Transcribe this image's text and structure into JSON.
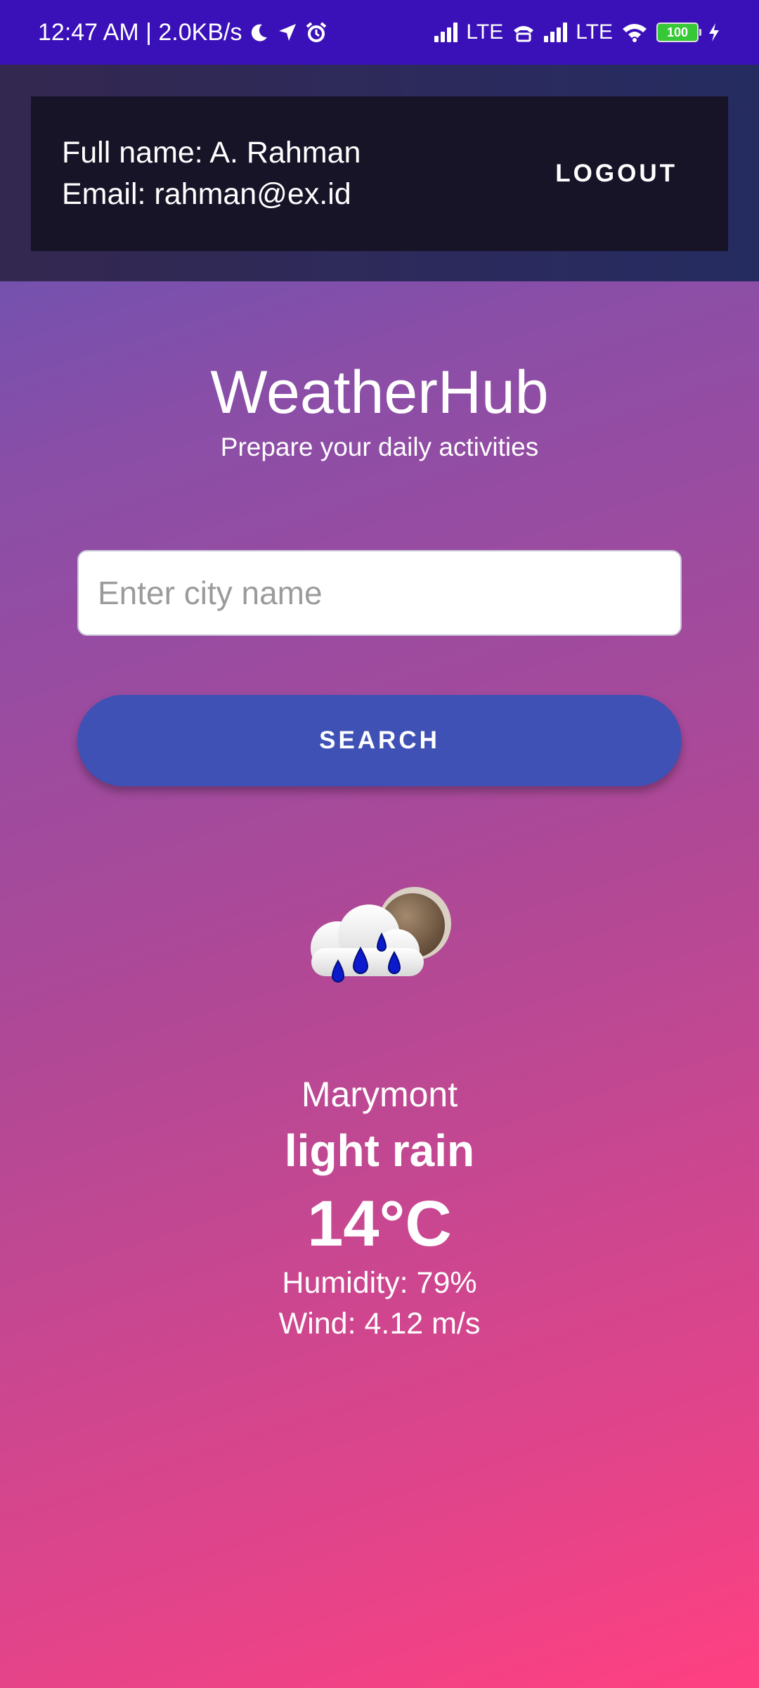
{
  "status_bar": {
    "time_speed": "12:47 AM | 2.0KB/s",
    "network_1": "LTE",
    "network_2": "LTE",
    "battery_level": "100",
    "icons": [
      "moon-icon",
      "location-arrow-icon",
      "alarm-icon",
      "signal-icon",
      "volte-icon",
      "signal-icon",
      "wifi-icon",
      "battery-icon",
      "charging-icon"
    ]
  },
  "user": {
    "full_name_line": "Full name: A. Rahman",
    "email_line": "Email: rahman@ex.id",
    "logout_label": "LOGOUT"
  },
  "app": {
    "title": "WeatherHub",
    "subtitle": "Prepare your daily activities"
  },
  "search": {
    "placeholder": "Enter city name",
    "value": "",
    "button_label": "SEARCH"
  },
  "weather": {
    "icon": "rain-cloud-moon-icon",
    "city": "Marymont",
    "description": "light rain",
    "temperature": "14°C",
    "humidity": "Humidity: 79%",
    "wind": "Wind: 4.12 m/s"
  },
  "colors": {
    "status_bar": "#3a10b8",
    "header_band": "#2c2a5d",
    "user_card": "#171428",
    "search_button": "#3f51b5",
    "gradient_top": "#3f4fb1",
    "gradient_bottom": "#ff4081"
  }
}
